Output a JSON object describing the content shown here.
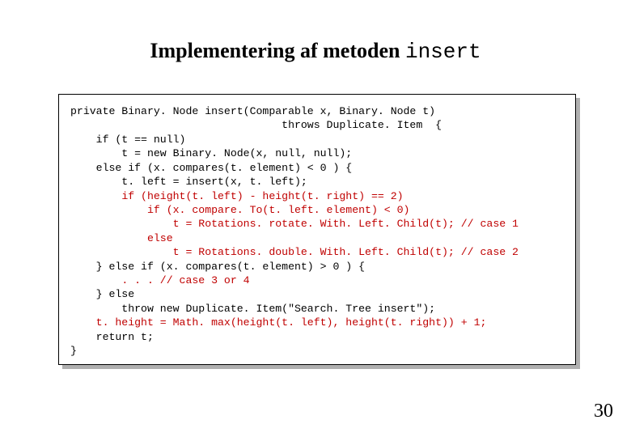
{
  "title": {
    "text": "Implementering af metoden ",
    "mono": "insert"
  },
  "code": {
    "l01": "private Binary. Node insert(Comparable x, Binary. Node t)",
    "l02": "                                 throws Duplicate. Item  {",
    "l03": "    if (t == null)",
    "l04": "        t = new Binary. Node(x, null, null);",
    "l05": "    else if (x. compares(t. element) < 0 ) {",
    "l06": "        t. left = insert(x, t. left);",
    "l07a": "        ",
    "l07b": "if (height(t. left) - height(t. right) == 2)",
    "l08a": "            ",
    "l08b": "if (x. compare. To(t. left. element) < 0)",
    "l09a": "                ",
    "l09b": "t = Rotations. rotate. With. Left. Child(t); // case 1",
    "l10a": "            ",
    "l10b": "else",
    "l11a": "                ",
    "l11b": "t = Rotations. double. With. Left. Child(t); // case 2",
    "l12": "    } else if (x. compares(t. element) > 0 ) {",
    "l13a": "        ",
    "l13b": ". . . // case 3 or 4",
    "l14": "    } else",
    "l15": "        throw new Duplicate. Item(\"Search. Tree insert\");",
    "l16a": "    ",
    "l16b": "t. height = Math. max(height(t. left), height(t. right)) + 1;",
    "l17": "    return t;",
    "l18": "}"
  },
  "pagenum": "30"
}
